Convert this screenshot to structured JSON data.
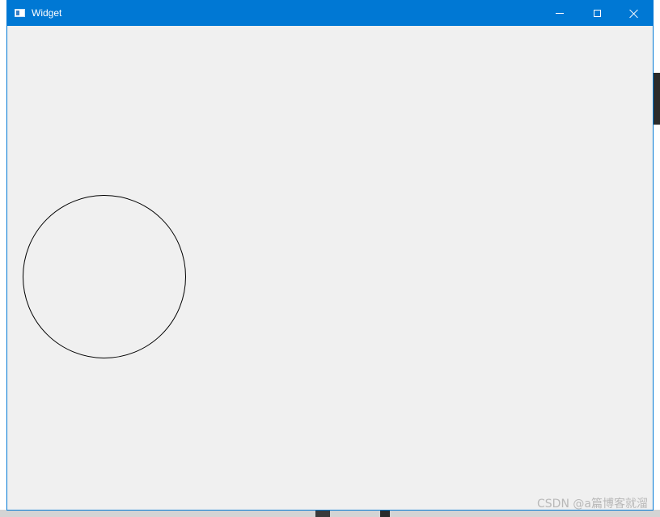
{
  "window": {
    "title": "Widget",
    "accent_color": "#0078d4",
    "client_background": "#f0f0f0",
    "icons": {
      "app": "app-window-icon",
      "minimize": "minimize-icon",
      "maximize": "maximize-icon",
      "close": "close-icon"
    }
  },
  "canvas": {
    "shape": "circle",
    "stroke_color": "#000000"
  },
  "watermark": {
    "text": "CSDN @a篇博客就溜"
  }
}
